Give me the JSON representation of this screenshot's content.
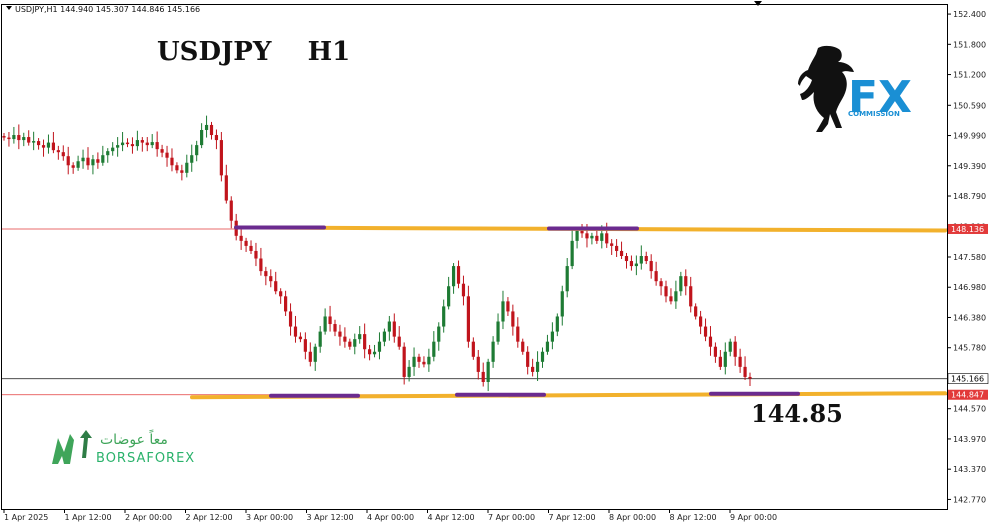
{
  "header": {
    "symbol_info": "USDJPY,H1  144.940 145.307 144.846 145.166"
  },
  "title": "USDJPY    H1",
  "logos": {
    "fx_commission": {
      "text": "FX",
      "subtext": "COMMISSION",
      "color": "#1a8fd4"
    },
    "borsaforex": {
      "arabic": "معاً عوضات",
      "text": "BORSAFOREX",
      "color": "#2ab26b"
    }
  },
  "annotation_price": "144.85",
  "colors": {
    "bull": "#1e7b34",
    "bear": "#c0141c",
    "resistance": "#f2b12c",
    "touch": "#6b2b8f",
    "price_line": "#e23a3a",
    "current_line": "#333333"
  },
  "chart_data": {
    "type": "candlestick",
    "symbol": "USDJPY",
    "timeframe": "H1",
    "y_ticks": [
      "152.400",
      "151.800",
      "151.200",
      "150.590",
      "149.990",
      "149.390",
      "148.790",
      "148.190",
      "147.580",
      "146.980",
      "146.380",
      "145.780",
      "145.170",
      "144.570",
      "143.970",
      "143.370",
      "142.770"
    ],
    "x_labels": [
      "1 Apr 2025",
      "1 Apr 12:00",
      "2 Apr 00:00",
      "2 Apr 12:00",
      "3 Apr 00:00",
      "3 Apr 12:00",
      "4 Apr 00:00",
      "4 Apr 12:00",
      "7 Apr 00:00",
      "7 Apr 12:00",
      "8 Apr 00:00",
      "8 Apr 12:00",
      "9 Apr 00:00"
    ],
    "ylim": [
      142.58,
      152.58
    ],
    "levels": [
      {
        "name": "resistance",
        "value": 148.136,
        "label": "148.136"
      },
      {
        "name": "support",
        "value": 144.847,
        "label": "144.847"
      },
      {
        "name": "current",
        "value": 145.166,
        "label": "145.166"
      }
    ],
    "closes": [
      149.95,
      149.92,
      150.0,
      149.9,
      149.96,
      149.85,
      149.88,
      149.8,
      149.75,
      149.85,
      149.7,
      149.66,
      149.58,
      149.4,
      149.35,
      149.48,
      149.55,
      149.4,
      149.52,
      149.45,
      149.6,
      149.68,
      149.75,
      149.8,
      149.85,
      149.82,
      149.78,
      149.9,
      149.85,
      149.8,
      149.86,
      149.72,
      149.65,
      149.55,
      149.4,
      149.3,
      149.25,
      149.45,
      149.6,
      149.8,
      150.1,
      150.2,
      150.0,
      149.9,
      149.2,
      148.7,
      148.3,
      148.0,
      147.9,
      147.8,
      147.7,
      147.55,
      147.3,
      147.2,
      147.1,
      146.9,
      146.8,
      146.5,
      146.2,
      146.0,
      145.95,
      145.7,
      145.5,
      145.8,
      146.1,
      146.4,
      146.25,
      146.1,
      146.0,
      145.9,
      145.8,
      145.95,
      146.05,
      145.75,
      145.65,
      145.7,
      145.9,
      146.1,
      146.3,
      146.0,
      145.8,
      145.2,
      145.4,
      145.6,
      145.5,
      145.45,
      145.6,
      145.9,
      146.2,
      146.6,
      147.0,
      147.4,
      147.05,
      146.8,
      145.9,
      145.6,
      145.3,
      145.1,
      145.5,
      145.9,
      146.3,
      146.7,
      146.5,
      146.2,
      145.9,
      145.7,
      145.4,
      145.3,
      145.5,
      145.7,
      145.9,
      146.1,
      146.4,
      146.9,
      147.4,
      147.9,
      148.1,
      148.05,
      147.95,
      148.0,
      147.9,
      148.05,
      147.85,
      147.8,
      147.7,
      147.6,
      147.5,
      147.4,
      147.45,
      147.6,
      147.5,
      147.3,
      147.1,
      147.0,
      146.8,
      146.7,
      146.9,
      147.2,
      147.0,
      146.6,
      146.4,
      146.2,
      146.0,
      145.8,
      145.6,
      145.4,
      145.7,
      145.9,
      145.6,
      145.4,
      145.2,
      145.17
    ]
  }
}
